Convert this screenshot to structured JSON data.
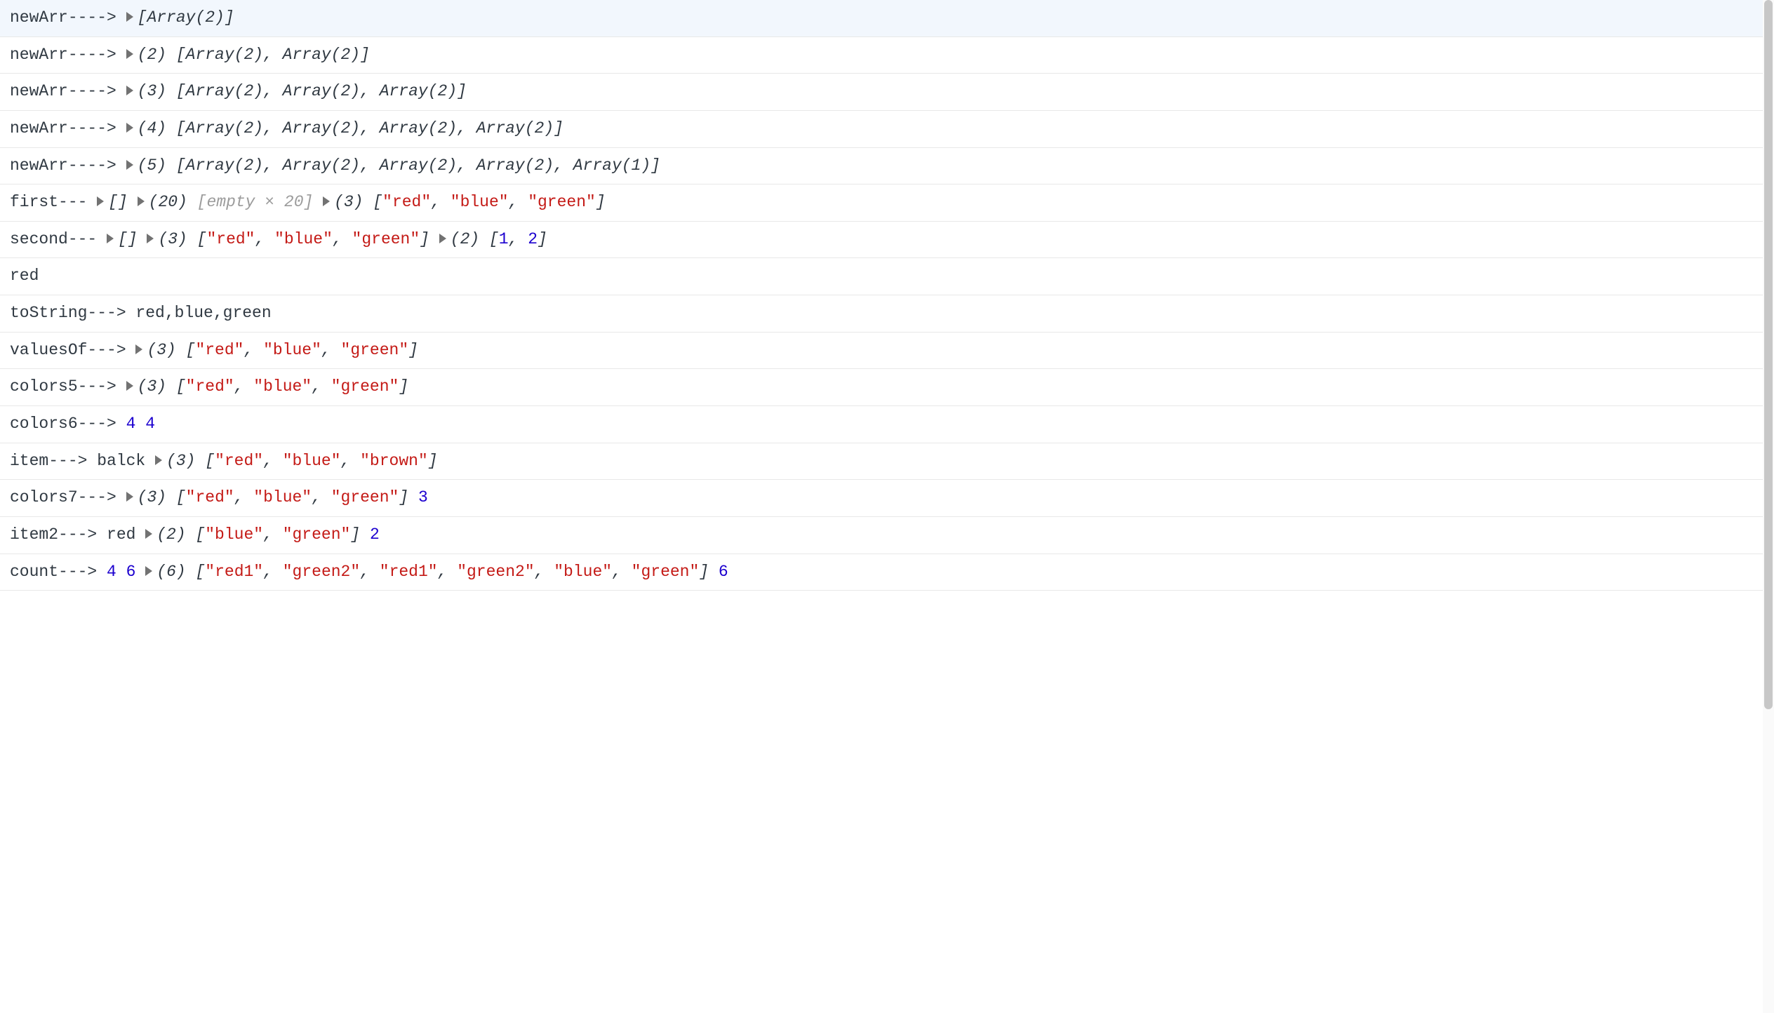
{
  "rows": [
    {
      "segments": [
        {
          "kind": "plain",
          "text": "newArr----> "
        },
        {
          "kind": "tri"
        },
        {
          "kind": "italic",
          "text": "[Array(2)]"
        }
      ]
    },
    {
      "segments": [
        {
          "kind": "plain",
          "text": "newArr----> "
        },
        {
          "kind": "tri"
        },
        {
          "kind": "italic",
          "text": "(2) [Array(2), Array(2)]"
        }
      ]
    },
    {
      "segments": [
        {
          "kind": "plain",
          "text": "newArr----> "
        },
        {
          "kind": "tri"
        },
        {
          "kind": "italic",
          "text": "(3) [Array(2), Array(2), Array(2)]"
        }
      ]
    },
    {
      "segments": [
        {
          "kind": "plain",
          "text": "newArr----> "
        },
        {
          "kind": "tri"
        },
        {
          "kind": "italic",
          "text": "(4) [Array(2), Array(2), Array(2), Array(2)]"
        }
      ]
    },
    {
      "segments": [
        {
          "kind": "plain",
          "text": "newArr----> "
        },
        {
          "kind": "tri"
        },
        {
          "kind": "italic",
          "text": "(5) [Array(2), Array(2), Array(2), Array(2), Array(1)]"
        }
      ]
    },
    {
      "segments": [
        {
          "kind": "plain",
          "text": "first--- "
        },
        {
          "kind": "tri"
        },
        {
          "kind": "italic",
          "text": "[] "
        },
        {
          "kind": "tri"
        },
        {
          "kind": "italic",
          "text": "(20) "
        },
        {
          "kind": "dim-italic",
          "text": "[empty × 20]"
        },
        {
          "kind": "plain",
          "text": " "
        },
        {
          "kind": "tri"
        },
        {
          "kind": "italic",
          "text": "(3) ["
        },
        {
          "kind": "str",
          "text": "\"red\""
        },
        {
          "kind": "italic",
          "text": ", "
        },
        {
          "kind": "str",
          "text": "\"blue\""
        },
        {
          "kind": "italic",
          "text": ", "
        },
        {
          "kind": "str",
          "text": "\"green\""
        },
        {
          "kind": "italic",
          "text": "]"
        }
      ]
    },
    {
      "segments": [
        {
          "kind": "plain",
          "text": "second--- "
        },
        {
          "kind": "tri"
        },
        {
          "kind": "italic",
          "text": "[] "
        },
        {
          "kind": "tri"
        },
        {
          "kind": "italic",
          "text": "(3) ["
        },
        {
          "kind": "str",
          "text": "\"red\""
        },
        {
          "kind": "italic",
          "text": ", "
        },
        {
          "kind": "str",
          "text": "\"blue\""
        },
        {
          "kind": "italic",
          "text": ", "
        },
        {
          "kind": "str",
          "text": "\"green\""
        },
        {
          "kind": "italic",
          "text": "] "
        },
        {
          "kind": "tri"
        },
        {
          "kind": "italic",
          "text": "(2) ["
        },
        {
          "kind": "num",
          "text": "1"
        },
        {
          "kind": "italic",
          "text": ", "
        },
        {
          "kind": "num",
          "text": "2"
        },
        {
          "kind": "italic",
          "text": "]"
        }
      ]
    },
    {
      "segments": [
        {
          "kind": "plain",
          "text": "red"
        }
      ]
    },
    {
      "segments": [
        {
          "kind": "plain",
          "text": "toString---> red,blue,green"
        }
      ]
    },
    {
      "segments": [
        {
          "kind": "plain",
          "text": "valuesOf---> "
        },
        {
          "kind": "tri"
        },
        {
          "kind": "italic",
          "text": "(3) ["
        },
        {
          "kind": "str",
          "text": "\"red\""
        },
        {
          "kind": "italic",
          "text": ", "
        },
        {
          "kind": "str",
          "text": "\"blue\""
        },
        {
          "kind": "italic",
          "text": ", "
        },
        {
          "kind": "str",
          "text": "\"green\""
        },
        {
          "kind": "italic",
          "text": "]"
        }
      ]
    },
    {
      "segments": [
        {
          "kind": "plain",
          "text": "colors5---> "
        },
        {
          "kind": "tri"
        },
        {
          "kind": "italic",
          "text": "(3) ["
        },
        {
          "kind": "str",
          "text": "\"red\""
        },
        {
          "kind": "italic",
          "text": ", "
        },
        {
          "kind": "str",
          "text": "\"blue\""
        },
        {
          "kind": "italic",
          "text": ", "
        },
        {
          "kind": "str",
          "text": "\"green\""
        },
        {
          "kind": "italic",
          "text": "]"
        }
      ]
    },
    {
      "segments": [
        {
          "kind": "plain",
          "text": "colors6---> "
        },
        {
          "kind": "num",
          "text": "4"
        },
        {
          "kind": "plain",
          "text": " "
        },
        {
          "kind": "num",
          "text": "4"
        }
      ]
    },
    {
      "segments": [
        {
          "kind": "plain",
          "text": "item---> balck "
        },
        {
          "kind": "tri"
        },
        {
          "kind": "italic",
          "text": "(3) ["
        },
        {
          "kind": "str",
          "text": "\"red\""
        },
        {
          "kind": "italic",
          "text": ", "
        },
        {
          "kind": "str",
          "text": "\"blue\""
        },
        {
          "kind": "italic",
          "text": ", "
        },
        {
          "kind": "str",
          "text": "\"brown\""
        },
        {
          "kind": "italic",
          "text": "]"
        }
      ]
    },
    {
      "segments": [
        {
          "kind": "plain",
          "text": "colors7---> "
        },
        {
          "kind": "tri"
        },
        {
          "kind": "italic",
          "text": "(3) ["
        },
        {
          "kind": "str",
          "text": "\"red\""
        },
        {
          "kind": "italic",
          "text": ", "
        },
        {
          "kind": "str",
          "text": "\"blue\""
        },
        {
          "kind": "italic",
          "text": ", "
        },
        {
          "kind": "str",
          "text": "\"green\""
        },
        {
          "kind": "italic",
          "text": "]"
        },
        {
          "kind": "plain",
          "text": " "
        },
        {
          "kind": "num",
          "text": "3"
        }
      ]
    },
    {
      "segments": [
        {
          "kind": "plain",
          "text": "item2---> red "
        },
        {
          "kind": "tri"
        },
        {
          "kind": "italic",
          "text": "(2) ["
        },
        {
          "kind": "str",
          "text": "\"blue\""
        },
        {
          "kind": "italic",
          "text": ", "
        },
        {
          "kind": "str",
          "text": "\"green\""
        },
        {
          "kind": "italic",
          "text": "]"
        },
        {
          "kind": "plain",
          "text": " "
        },
        {
          "kind": "num",
          "text": "2"
        }
      ]
    },
    {
      "segments": [
        {
          "kind": "plain",
          "text": "count---> "
        },
        {
          "kind": "num",
          "text": "4"
        },
        {
          "kind": "plain",
          "text": " "
        },
        {
          "kind": "num",
          "text": "6"
        },
        {
          "kind": "plain",
          "text": " "
        },
        {
          "kind": "tri"
        },
        {
          "kind": "italic",
          "text": "(6) ["
        },
        {
          "kind": "str",
          "text": "\"red1\""
        },
        {
          "kind": "italic",
          "text": ", "
        },
        {
          "kind": "str",
          "text": "\"green2\""
        },
        {
          "kind": "italic",
          "text": ", "
        },
        {
          "kind": "str",
          "text": "\"red1\""
        },
        {
          "kind": "italic",
          "text": ", "
        },
        {
          "kind": "str",
          "text": "\"green2\""
        },
        {
          "kind": "italic",
          "text": ", "
        },
        {
          "kind": "str",
          "text": "\"blue\""
        },
        {
          "kind": "italic",
          "text": ", "
        },
        {
          "kind": "str",
          "text": "\"green\""
        },
        {
          "kind": "italic",
          "text": "]"
        },
        {
          "kind": "plain",
          "text": " "
        },
        {
          "kind": "num",
          "text": "6"
        }
      ]
    }
  ]
}
